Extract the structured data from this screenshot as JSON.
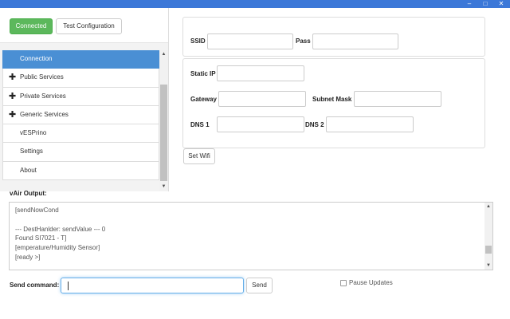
{
  "window": {
    "controls": {
      "minimize": "–",
      "maximize": "□",
      "close": "✕"
    }
  },
  "header": {
    "connected_label": "Connected",
    "test_config_label": "Test Configuration"
  },
  "nav": {
    "items": [
      {
        "label": "Connection",
        "has_plus": false,
        "active": true
      },
      {
        "label": "Public Services",
        "has_plus": true,
        "active": false
      },
      {
        "label": "Private Services",
        "has_plus": true,
        "active": false
      },
      {
        "label": "Generic Services",
        "has_plus": true,
        "active": false
      },
      {
        "label": "vESPrino",
        "has_plus": false,
        "active": false
      },
      {
        "label": "Settings",
        "has_plus": false,
        "active": false
      },
      {
        "label": "About",
        "has_plus": false,
        "active": false
      }
    ],
    "plus_glyph": "✚"
  },
  "wifi": {
    "ssid_label": "SSID",
    "ssid_value": "",
    "pass_label": "Pass",
    "pass_value": "",
    "static_ip_label": "Static IP",
    "static_ip_value": "",
    "gateway_label": "Gateway",
    "gateway_value": "",
    "subnet_label": "Subnet Mask",
    "subnet_value": "",
    "dns1_label": "DNS 1",
    "dns1_value": "",
    "dns2_label": "DNS 2",
    "dns2_value": "",
    "set_wifi_label": "Set Wifi"
  },
  "output": {
    "label": "vAir Output:",
    "lines": [
      "[sendNowCond",
      "",
      "--- DestHanlder: sendValue --- 0",
      "Found SI7021 - T]",
      "[emperature/Humidity Sensor]",
      "[ready >]"
    ]
  },
  "command": {
    "label": "Send command:",
    "value": "",
    "send_label": "Send",
    "pause_label": "Pause Updates",
    "pause_checked": false
  },
  "colors": {
    "titlebar": "#3c78d8",
    "success": "#5cb85c",
    "active_nav": "#4a8fd4",
    "focus_border": "#66afe9"
  }
}
